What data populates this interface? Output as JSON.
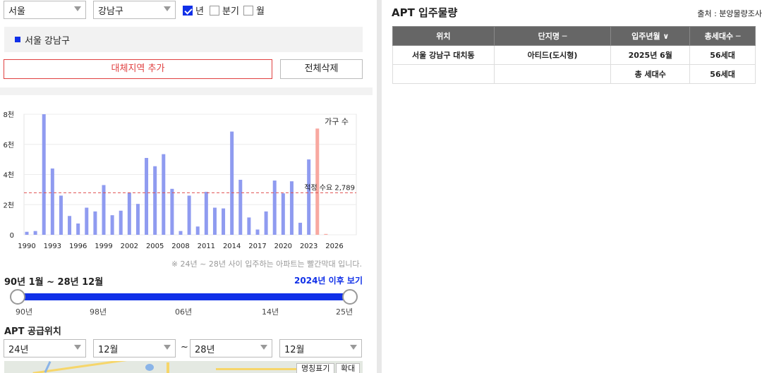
{
  "filters": {
    "city": "서울",
    "district": "강남구",
    "period_options": [
      {
        "label": "년",
        "checked": true
      },
      {
        "label": "분기",
        "checked": false
      },
      {
        "label": "월",
        "checked": false
      }
    ]
  },
  "selected_region": "서울 강남구",
  "buttons": {
    "add_region": "대체지역 추가",
    "delete_all": "전체삭제"
  },
  "chart_data": {
    "type": "bar",
    "x": [
      1990,
      1991,
      1992,
      1993,
      1994,
      1995,
      1996,
      1997,
      1998,
      1999,
      2000,
      2001,
      2002,
      2003,
      2004,
      2005,
      2006,
      2007,
      2008,
      2009,
      2010,
      2011,
      2012,
      2013,
      2014,
      2015,
      2016,
      2017,
      2018,
      2019,
      2020,
      2021,
      2022,
      2023,
      2024,
      2025,
      2026
    ],
    "values": [
      200,
      250,
      8000,
      4400,
      2600,
      1250,
      750,
      1800,
      1550,
      3300,
      1300,
      1600,
      2800,
      2050,
      5100,
      4550,
      5350,
      3050,
      250,
      2600,
      550,
      2850,
      1800,
      1750,
      6850,
      3650,
      1150,
      350,
      1550,
      3600,
      2750,
      3550,
      800,
      5000,
      7050,
      56,
      0
    ],
    "highlight_from": 2024,
    "bar_color": "#8f9bf0",
    "highlight_color": "#f8a8a0",
    "reference_line": {
      "value": 2789,
      "label": "적정 수요 2,789",
      "color": "#e05050"
    },
    "legend": "가구 수",
    "ytick_labels": [
      "0",
      "2천",
      "4천",
      "6천",
      "8천"
    ],
    "ytick_values": [
      0,
      2000,
      4000,
      6000,
      8000
    ],
    "xtick_labels": [
      "1990",
      "1993",
      "1996",
      "1999",
      "2002",
      "2005",
      "2008",
      "2011",
      "2014",
      "2017",
      "2020",
      "2023",
      "2026"
    ],
    "ylim": [
      0,
      8000
    ],
    "grid": true
  },
  "chart_note": "※ 24년 ~ 28년 사이 입주하는 아파트는 빨간막대 입니다.",
  "range": {
    "title": "90년 1월 ~ 28년 12월",
    "after_link": "2024년 이후 보기",
    "ticks": [
      "90년",
      "98년",
      "06년",
      "14년",
      "25년"
    ]
  },
  "supply_location": {
    "title": "APT 공급위치",
    "from_year": "24년",
    "from_month": "12월",
    "separator": "~",
    "to_year": "28년",
    "to_month": "12월",
    "map_buttons": [
      "명칭표기",
      "확대"
    ]
  },
  "right": {
    "title": "APT 입주물량",
    "source": "출처 : 분양물량조사",
    "headers": [
      "위치",
      "단지명 ─",
      "입주년월 ∨",
      "총세대수 ─"
    ],
    "rows": [
      [
        "서울 강남구 대치동",
        "아티드(도시형)",
        "2025년 6월",
        "56세대"
      ],
      [
        "",
        "",
        "총 세대수",
        "56세대"
      ]
    ]
  }
}
